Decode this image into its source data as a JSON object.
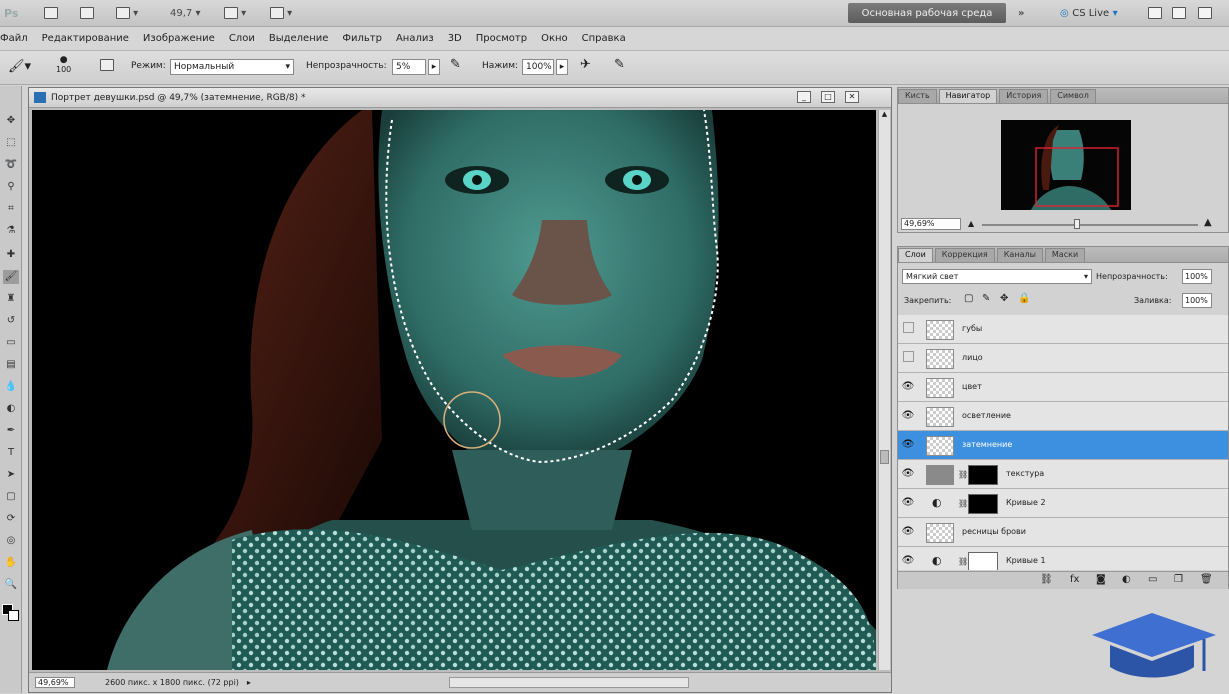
{
  "appbar": {
    "ps_logo": "Ps",
    "zoom": "49,7",
    "workspace": "Основная рабочая среда",
    "cslive": "CS Live"
  },
  "menu": [
    "Файл",
    "Редактирование",
    "Изображение",
    "Слои",
    "Выделение",
    "Фильтр",
    "Анализ",
    "3D",
    "Просмотр",
    "Окно",
    "Справка"
  ],
  "options": {
    "brush_size": "100",
    "mode_label": "Режим:",
    "mode_value": "Нормальный",
    "opacity_label": "Непрозрачность:",
    "opacity_value": "5%",
    "pressure_label": "Нажим:",
    "pressure_value": "100%"
  },
  "document": {
    "title": "Портрет девушки.psd @ 49,7% (затемнение, RGB/8) *",
    "status_zoom": "49,69%",
    "status_doc": "2600 пикс. x 1800 пикс. (72 ppi)"
  },
  "navigator": {
    "tabs": [
      "Кисть",
      "Навигатор",
      "История",
      "Символ"
    ],
    "active_tab": 1,
    "zoom": "49,69%"
  },
  "layers": {
    "tabs": [
      "Слои",
      "Коррекция",
      "Каналы",
      "Маски"
    ],
    "active_tab": 0,
    "blend_mode": "Мягкий свет",
    "opacity_label": "Непрозрачность:",
    "opacity_value": "100%",
    "lock_label": "Закрепить:",
    "fill_label": "Заливка:",
    "fill_value": "100%",
    "items": [
      {
        "name": "губы",
        "visible": false,
        "mask": false,
        "selected": false
      },
      {
        "name": "лицо",
        "visible": false,
        "mask": false,
        "selected": false
      },
      {
        "name": "цвет",
        "visible": true,
        "mask": false,
        "selected": false
      },
      {
        "name": "осветление",
        "visible": true,
        "mask": false,
        "selected": false
      },
      {
        "name": "затемнение",
        "visible": true,
        "mask": false,
        "selected": true
      },
      {
        "name": "текстура",
        "visible": true,
        "mask": true,
        "selected": false
      },
      {
        "name": "Кривые 2",
        "visible": true,
        "mask": true,
        "selected": false
      },
      {
        "name": "ресницы брови",
        "visible": true,
        "mask": false,
        "selected": false
      },
      {
        "name": "Кривые 1",
        "visible": true,
        "mask": true,
        "selected": false
      }
    ]
  },
  "colors": {
    "selection": "#3d8fe0",
    "workspace_btn": "#6a6a6a",
    "canvas_bg": "#000000",
    "skin_tint": "#3a8c84"
  }
}
